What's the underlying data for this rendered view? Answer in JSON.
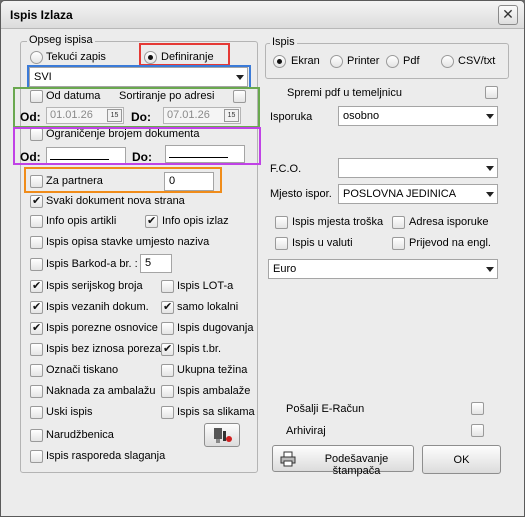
{
  "window": {
    "title": "Ispis Izlaza",
    "close_glyph": "✕"
  },
  "left": {
    "group_title": "Opseg ispisa",
    "radio_tekuci": "Tekući zapis",
    "radio_definiranje": "Definiranje",
    "scope_select": "SVI",
    "od_datuma": "Od datuma",
    "sortiranje": "Sortiranje po adresi",
    "od_label": "Od:",
    "do_label": "Do:",
    "date_from": "01.01.26",
    "date_to": "07.01.26",
    "cal_icon": "15",
    "ogranicenje": "Ograničenje brojem dokumenta",
    "doc_od_label": "Od:",
    "doc_do_label": "Do:",
    "za_partnera": "Za partnera",
    "za_partnera_value": "0",
    "svaki_dokument": "Svaki dokument nova strana",
    "info_artikli": "Info opis artikli",
    "info_izlaz": "Info opis izlaz",
    "ispis_opisa": "Ispis opisa stavke umjesto naziva",
    "barkod": "Ispis Barkod-a br. :",
    "barkod_value": "5",
    "serijskog": "Ispis serijskog broja",
    "lot": "Ispis LOT-a",
    "vezanih": "Ispis vezanih dokum.",
    "samo_lokalni": "samo lokalni",
    "porezne": "Ispis porezne osnovice",
    "dugovanja": "Ispis dugovanja",
    "bez_iznosa": "Ispis bez iznosa poreza",
    "tbr": "Ispis t.br.",
    "oznaci": "Označi tiskano",
    "tezina": "Ukupna težina",
    "naknada": "Naknada za ambalažu",
    "ambalaze": "Ispis ambalaže",
    "uski": "Uski ispis",
    "slikama": "Ispis sa slikama",
    "narudzbenica": "Narudžbenica",
    "rasporeda": "Ispis rasporeda slaganja"
  },
  "right": {
    "group_title": "Ispis",
    "ekran": "Ekran",
    "printer": "Printer",
    "pdf": "Pdf",
    "csv": "CSV/txt",
    "spremi_pdf": "Spremi pdf u temeljnicu",
    "isporuka_label": "Isporuka",
    "isporuka_value": "osobno",
    "fco_label": "F.C.O.",
    "fco_value": "",
    "mjesto_label": "Mjesto ispor.",
    "mjesto_value": "POSLOVNA JEDINICA",
    "mjesta_troska": "Ispis mjesta troška",
    "adresa_isporuke": "Adresa isporuke",
    "u_valuti": "Ispis u valuti",
    "prijevod": "Prijevod na engl.",
    "valuta": "Euro",
    "posalji": "Pošalji E-Račun",
    "arhiviraj": "Arhiviraj",
    "podesavanje": "Podešavanje štampača",
    "ok": "OK"
  },
  "highlight_colors": {
    "red": "#e53935",
    "blue": "#3b7bd8",
    "green": "#6aa84f",
    "purple": "#c042e6",
    "orange": "#f08c1a"
  }
}
